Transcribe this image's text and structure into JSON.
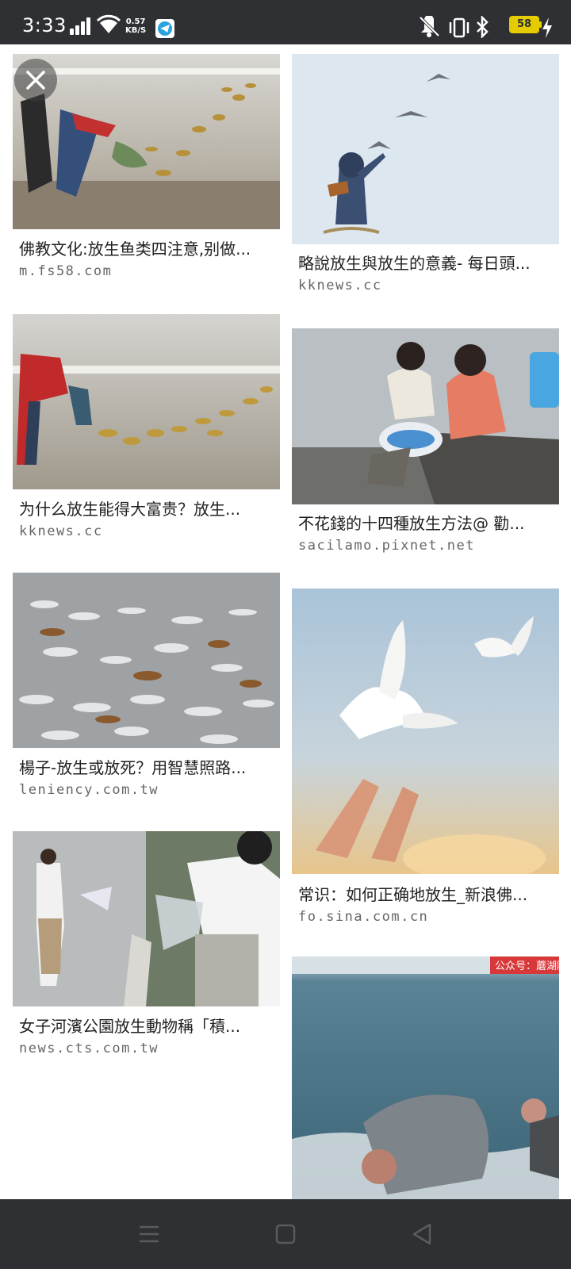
{
  "status_bar": {
    "time": "3:33",
    "net_speed_value": "0.57",
    "net_speed_unit": "KB/S",
    "battery_level": "58",
    "icons": [
      "signal-icon",
      "wifi-icon",
      "telegram-icon",
      "vibrate-off-icon",
      "vibrate-icon",
      "bluetooth-icon",
      "battery-icon",
      "charging-icon"
    ]
  },
  "results": {
    "left": [
      {
        "caption": "佛教文化:放生鱼类四注意,别做...",
        "source": "m.fs58.com"
      },
      {
        "caption": "为什么放生能得大富贵？放生...",
        "source": "kknews.cc"
      },
      {
        "caption": "楊子-放生或放死？用智慧照路...",
        "source": "leniency.com.tw"
      },
      {
        "caption": "女子河濱公園放生動物稱「積...",
        "source": "news.cts.com.tw"
      }
    ],
    "right": [
      {
        "caption": "略說放生與放生的意義- 每日頭...",
        "source": "kknews.cc"
      },
      {
        "caption": "不花錢的十四種放生方法@ 勸...",
        "source": "sacilamo.pixnet.net"
      },
      {
        "caption": "常识：如何正确地放生_新浪佛...",
        "source": "fo.sina.com.cn"
      },
      {
        "caption": "",
        "source": ""
      }
    ],
    "watermark_text": "公众号：蘑湖阿"
  },
  "nav": {
    "buttons": [
      "menu-icon",
      "home-icon",
      "back-icon"
    ]
  },
  "colors": {
    "bar_bg": "#2f3033",
    "battery": "#e5cc00",
    "telegram": "#2aa3dd"
  }
}
